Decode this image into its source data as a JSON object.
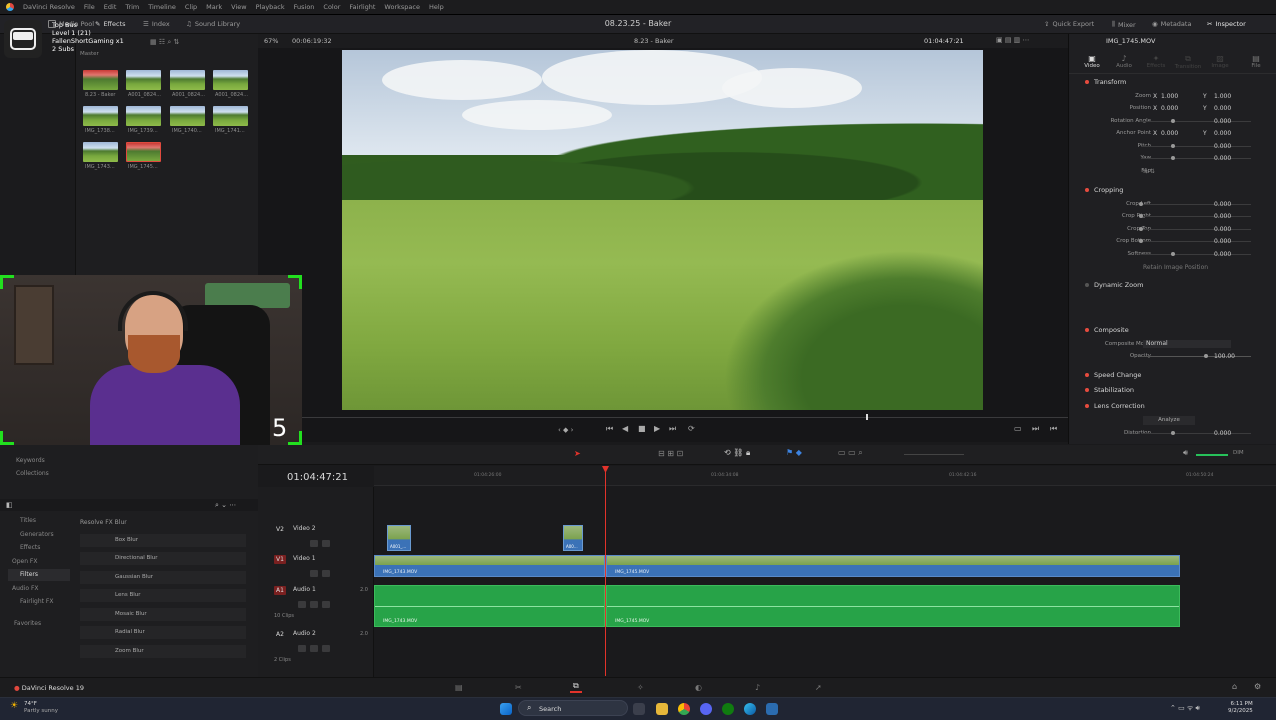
{
  "menubar": {
    "items": [
      "DaVinci Resolve",
      "File",
      "Edit",
      "Trim",
      "Timeline",
      "Clip",
      "Mark",
      "View",
      "Playback",
      "Fusion",
      "Color",
      "Fairlight",
      "Workspace",
      "Help"
    ]
  },
  "toolbar": {
    "media_pool": "Media Pool",
    "effects": "Effects",
    "index": "Index",
    "sound_library": "Sound Library",
    "project_title": "08.23.25 - Baker",
    "quick_export": "Quick Export",
    "mixer": "Mixer",
    "metadata": "Metadata",
    "inspector": "Inspector"
  },
  "overlay": {
    "top_bus": "Top Bus",
    "level": "Level 1  (21)",
    "user": "FallenShortGaming x1",
    "subs": "2 Subs",
    "master": "Master",
    "counter": "5"
  },
  "mediapool": {
    "clips": [
      "8.23 - Baker",
      "A001_0824...",
      "A001_0824...",
      "A001_0824...",
      "IMG_1738...",
      "IMG_1739...",
      "IMG_1740...",
      "IMG_1741...",
      "IMG_1743...",
      "IMG_1745..."
    ]
  },
  "viewer": {
    "zoom": "67%",
    "duration": "00:06:19:32",
    "timeline_name": "8.23 - Baker",
    "timecode": "01:04:47:21"
  },
  "inspector": {
    "clip_name": "IMG_1745.MOV",
    "tabs": [
      "Video",
      "Audio",
      "Effects",
      "Transition",
      "Image",
      "File"
    ],
    "transform": {
      "title": "Transform",
      "zoom_label": "Zoom",
      "zoom_x": "1.000",
      "zoom_y": "1.000",
      "position_label": "Position",
      "pos_x": "0.000",
      "pos_y": "0.000",
      "rotation_label": "Rotation Angle",
      "rotation": "0.000",
      "anchor_label": "Anchor Point",
      "anchor_x": "0.000",
      "anchor_y": "0.000",
      "pitch_label": "Pitch",
      "pitch": "0.000",
      "yaw_label": "Yaw",
      "yaw": "0.000",
      "flip_label": "Flip"
    },
    "cropping": {
      "title": "Cropping",
      "left_label": "Crop Left",
      "left": "0.000",
      "right_label": "Crop Right",
      "right": "0.000",
      "top_label": "Crop Top",
      "top": "0.000",
      "bottom_label": "Crop Bottom",
      "bottom": "0.000",
      "soft_label": "Softness",
      "soft": "0.000",
      "retain": "Retain Image Position"
    },
    "dynamic_zoom": "Dynamic Zoom",
    "composite": {
      "title": "Composite",
      "mode_label": "Composite Mode",
      "mode": "Normal",
      "opacity_label": "Opacity",
      "opacity": "100.00"
    },
    "speed_change": "Speed Change",
    "stabilization": "Stabilization",
    "lens_correction": "Lens Correction",
    "analyze": "Analyze",
    "distortion_label": "Distortion",
    "distortion": "0.000"
  },
  "effects": {
    "tree": [
      "Keywords",
      "Collections",
      "Titles",
      "Generators",
      "Effects",
      "Open FX",
      "Filters",
      "Audio FX",
      "Fairlight FX",
      "Favorites"
    ],
    "group": "Resolve FX Blur",
    "items": [
      "Box Blur",
      "Directional Blur",
      "Gaussian Blur",
      "Lens Blur",
      "Mosaic Blur",
      "Radial Blur",
      "Zoom Blur"
    ]
  },
  "timeline": {
    "timecode": "01:04:47:21",
    "ruler": [
      "01:04:26:00",
      "01:04:34:08",
      "01:04:42:16",
      "01:04:50:24"
    ],
    "tracks": [
      {
        "tag": "V2",
        "name": "Video 2",
        "sub": ""
      },
      {
        "tag": "V1",
        "name": "Video 1",
        "sub": ""
      },
      {
        "tag": "A1",
        "name": "Audio 1",
        "sub": "10 Clips",
        "level": "2.0"
      },
      {
        "tag": "A2",
        "name": "Audio 2",
        "sub": "2 Clips",
        "level": "2.0"
      }
    ],
    "clip_v2a": "A001_...",
    "clip_v2b": "A00...",
    "clip_v1a": "IMG_1743.MOV",
    "clip_v1b": "IMG_1745.MOV",
    "clip_a1a": "IMG_1743.MOV",
    "clip_a1b": "IMG_1745.MOV",
    "audio_level": "DIM"
  },
  "pagebar": {
    "app": "DaVinci Resolve 19"
  },
  "taskbar": {
    "weather_temp": "74°F",
    "weather_desc": "Partly sunny",
    "search": "Search",
    "time": "6:11 PM",
    "date": "9/2/2025"
  }
}
